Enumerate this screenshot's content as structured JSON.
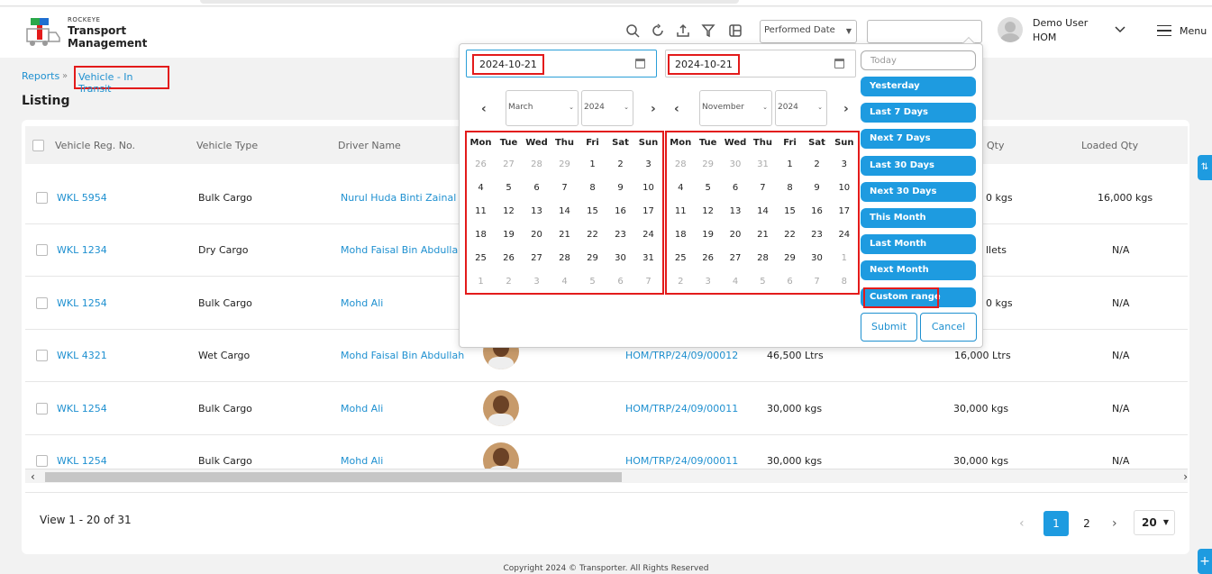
{
  "header": {
    "brand_small": "ROCKEYE",
    "brand_line1": "Transport",
    "brand_line2": "Management",
    "icons": [
      "search-icon",
      "refresh-icon",
      "upload-icon",
      "filter-icon",
      "layout-icon"
    ],
    "date_type_select": "Performed Date",
    "user_name": "Demo User",
    "user_org": "HOM",
    "menu_label": "Menu"
  },
  "breadcrumb": {
    "reports": "Reports",
    "current": "Vehicle - In Transit"
  },
  "page_title": "Listing",
  "table": {
    "headers": [
      "Vehicle Reg. No.",
      "Vehicle Type",
      "Driver Name",
      "Qty",
      "Loaded Qty"
    ],
    "rows": [
      {
        "reg": "WKL 5954",
        "type": "Bulk Cargo",
        "driver": "Nurul Huda Binti Zainal",
        "trip": "",
        "qty": "",
        "qty2": "0 kgs",
        "loaded": "16,000 kgs"
      },
      {
        "reg": "WKL 1234",
        "type": "Dry Cargo",
        "driver": "Mohd Faisal Bin Abdullah",
        "trip": "",
        "qty": "",
        "qty2": "llets",
        "loaded": "N/A"
      },
      {
        "reg": "WKL 1254",
        "type": "Bulk Cargo",
        "driver": "Mohd Ali",
        "trip": "",
        "qty": "",
        "qty2": "0 kgs",
        "loaded": "N/A"
      },
      {
        "reg": "WKL 4321",
        "type": "Wet Cargo",
        "driver": "Mohd Faisal Bin Abdullah",
        "trip": "HOM/TRP/24/09/00012",
        "qty": "46,500 Ltrs",
        "qty2": "16,000 Ltrs",
        "loaded": "N/A"
      },
      {
        "reg": "WKL 1254",
        "type": "Bulk Cargo",
        "driver": "Mohd Ali",
        "trip": "HOM/TRP/24/09/00011",
        "qty": "30,000 kgs",
        "qty2": "30,000 kgs",
        "loaded": "N/A"
      },
      {
        "reg": "WKL 1254",
        "type": "Bulk Cargo",
        "driver": "Mohd Ali",
        "trip": "HOM/TRP/24/09/00011",
        "qty": "30,000 kgs",
        "qty2": "30,000 kgs",
        "loaded": "N/A"
      }
    ]
  },
  "pagination": {
    "view_text": "View 1 - 20 of 31",
    "pages": [
      "1",
      "2"
    ],
    "page_size": "20"
  },
  "footer": "Copyright 2024 © Transporter. All Rights Reserved",
  "datepicker": {
    "start_date": "2024-10-21",
    "end_date": "2024-10-21",
    "left_month": "March",
    "left_year": "2024",
    "right_month": "November",
    "right_year": "2024",
    "weekdays": [
      "Mon",
      "Tue",
      "Wed",
      "Thu",
      "Fri",
      "Sat",
      "Sun"
    ],
    "left_weeks": [
      [
        "26",
        "27",
        "28",
        "29",
        "1",
        "2",
        "3"
      ],
      [
        "4",
        "5",
        "6",
        "7",
        "8",
        "9",
        "10"
      ],
      [
        "11",
        "12",
        "13",
        "14",
        "15",
        "16",
        "17"
      ],
      [
        "18",
        "19",
        "20",
        "21",
        "22",
        "23",
        "24"
      ],
      [
        "25",
        "26",
        "27",
        "28",
        "29",
        "30",
        "31"
      ],
      [
        "1",
        "2",
        "3",
        "4",
        "5",
        "6",
        "7"
      ]
    ],
    "left_off": [
      [
        0,
        1,
        2,
        3
      ],
      [],
      [],
      [],
      [],
      [
        0,
        1,
        2,
        3,
        4,
        5,
        6
      ]
    ],
    "right_weeks": [
      [
        "28",
        "29",
        "30",
        "31",
        "1",
        "2",
        "3"
      ],
      [
        "4",
        "5",
        "6",
        "7",
        "8",
        "9",
        "10"
      ],
      [
        "11",
        "12",
        "13",
        "14",
        "15",
        "16",
        "17"
      ],
      [
        "18",
        "19",
        "20",
        "21",
        "22",
        "23",
        "24"
      ],
      [
        "25",
        "26",
        "27",
        "28",
        "29",
        "30",
        "1"
      ],
      [
        "2",
        "3",
        "4",
        "5",
        "6",
        "7",
        "8"
      ]
    ],
    "right_off": [
      [
        0,
        1,
        2,
        3
      ],
      [],
      [],
      [],
      [
        6
      ],
      [
        0,
        1,
        2,
        3,
        4,
        5,
        6
      ]
    ],
    "ranges": [
      "Today",
      "Yesterday",
      "Last 7 Days",
      "Next 7 Days",
      "Last 30 Days",
      "Next 30 Days",
      "This Month",
      "Last Month",
      "Next Month",
      "Custom range"
    ],
    "submit_label": "Submit",
    "cancel_label": "Cancel"
  },
  "colors": {
    "accent": "#1e9be0",
    "link": "#1e90d0",
    "highlight": "#e31b1b"
  }
}
